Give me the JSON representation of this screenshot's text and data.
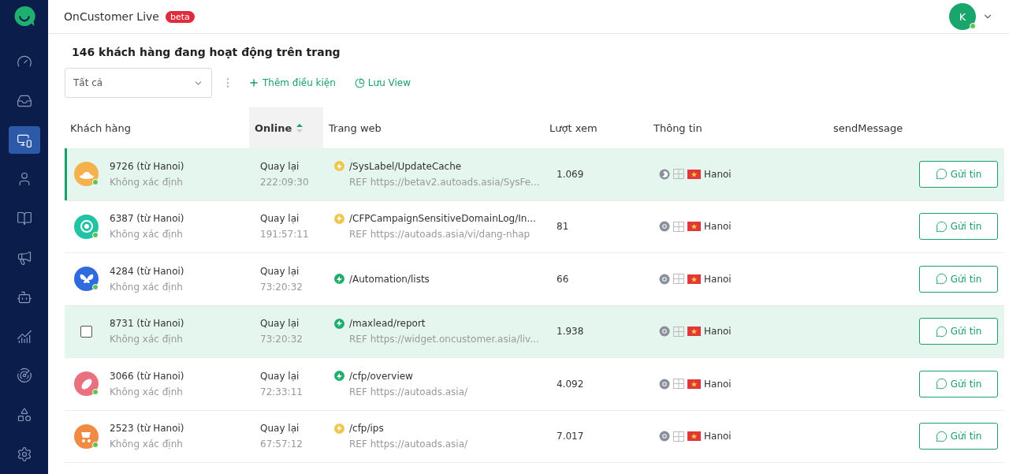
{
  "sidebar": {
    "items": [
      {
        "kind": "gauge",
        "selected": false
      },
      {
        "kind": "inbox",
        "selected": false
      },
      {
        "kind": "monitor",
        "selected": true
      },
      {
        "kind": "user",
        "selected": false
      },
      {
        "kind": "book",
        "selected": false
      },
      {
        "kind": "megaphone",
        "selected": false
      },
      {
        "kind": "bot",
        "selected": false
      },
      {
        "kind": "chart",
        "selected": false
      },
      {
        "kind": "radar",
        "selected": false
      },
      {
        "kind": "apps",
        "selected": false
      },
      {
        "kind": "settings",
        "selected": false
      }
    ]
  },
  "header": {
    "title": "OnCustomer Live",
    "badge": "beta",
    "user_initial": "K"
  },
  "summary": "146 khách hàng đang hoạt động trên trang",
  "filter": {
    "value": "Tất cả",
    "actions": [
      {
        "kind": "add",
        "label": "Thêm điều kiện"
      },
      {
        "kind": "save",
        "label": "Lưu View"
      }
    ]
  },
  "table": {
    "columns": [
      {
        "label": "Khách hàng",
        "sorted": false
      },
      {
        "label": "Online",
        "sorted": true
      },
      {
        "label": "Trang web",
        "sorted": false
      },
      {
        "label": "Lượt xem",
        "sorted": false
      },
      {
        "label": "Thông tin",
        "sorted": false
      },
      {
        "label": "sendMessage",
        "sorted": false
      }
    ],
    "rows": [
      {
        "kind": "avatar",
        "avatar": {
          "kind": "hat",
          "color": "#f5b14c"
        },
        "selected": true,
        "highlighted": true,
        "name": "9726 (từ Hanoi)",
        "sub": "Không xác định",
        "status": "Quay lại",
        "time": "222:09:30",
        "page": {
          "path": "/SysLabel/UpdateCache",
          "color": "#f0c64a"
        },
        "ref": "REF https://betav2.autoads.asia/SysFe...",
        "views": "1.069",
        "browser": {
          "kind": "firefox"
        },
        "city": "Hanoi",
        "button": "Gửi tin"
      },
      {
        "kind": "avatar",
        "avatar": {
          "kind": "planet",
          "color": "#20c4a4"
        },
        "selected": false,
        "highlighted": false,
        "name": "6387 (từ Hanoi)",
        "sub": "Không xác định",
        "status": "Quay lại",
        "time": "191:57:11",
        "page": {
          "path": "/CFPCampaignSensitiveDomainLog/In...",
          "color": "#f0c64a"
        },
        "ref": "REF https://autoads.asia/vi/dang-nhap",
        "views": "81",
        "browser": {
          "kind": "chrome"
        },
        "city": "Hanoi",
        "button": "Gửi tin"
      },
      {
        "kind": "avatar",
        "avatar": {
          "kind": "butterfly",
          "color": "#2f6bdc"
        },
        "selected": false,
        "highlighted": false,
        "name": "4284 (từ Hanoi)",
        "sub": "Không xác định",
        "status": "Quay lại",
        "time": "73:20:32",
        "page": {
          "path": "/Automation/lists",
          "color": "#1fae6e"
        },
        "views": "66",
        "browser": {
          "kind": "chrome"
        },
        "city": "Hanoi",
        "button": "Gửi tin"
      },
      {
        "kind": "checkbox",
        "checked": false,
        "selected": false,
        "highlighted": true,
        "name": "8731 (từ Hanoi)",
        "sub": "Không xác định",
        "status": "Quay lại",
        "time": "73:20:32",
        "page": {
          "path": "/maxlead/report",
          "color": "#1fae6e"
        },
        "ref": "REF https://widget.oncustomer.asia/liv...",
        "views": "1.938",
        "browser": {
          "kind": "chrome"
        },
        "city": "Hanoi",
        "button": "Gửi tin"
      },
      {
        "kind": "avatar",
        "avatar": {
          "kind": "ball",
          "color": "#e9707f"
        },
        "selected": false,
        "highlighted": false,
        "name": "3066 (từ Hanoi)",
        "sub": "Không xác định",
        "status": "Quay lại",
        "time": "72:33:11",
        "page": {
          "path": "/cfp/overview",
          "color": "#1fae6e"
        },
        "ref": "REF https://autoads.asia/",
        "views": "4.092",
        "browser": {
          "kind": "chrome"
        },
        "city": "Hanoi",
        "button": "Gửi tin"
      },
      {
        "kind": "avatar",
        "avatar": {
          "kind": "stroller",
          "color": "#f08a45"
        },
        "selected": false,
        "highlighted": false,
        "name": "2523 (từ Hanoi)",
        "sub": "Không xác định",
        "status": "Quay lại",
        "time": "67:57:12",
        "page": {
          "path": "/cfp/ips",
          "color": "#f0c64a"
        },
        "ref": "REF https://autoads.asia/",
        "views": "7.017",
        "browser": {
          "kind": "chrome"
        },
        "city": "Hanoi",
        "button": "Gửi tin"
      }
    ]
  }
}
